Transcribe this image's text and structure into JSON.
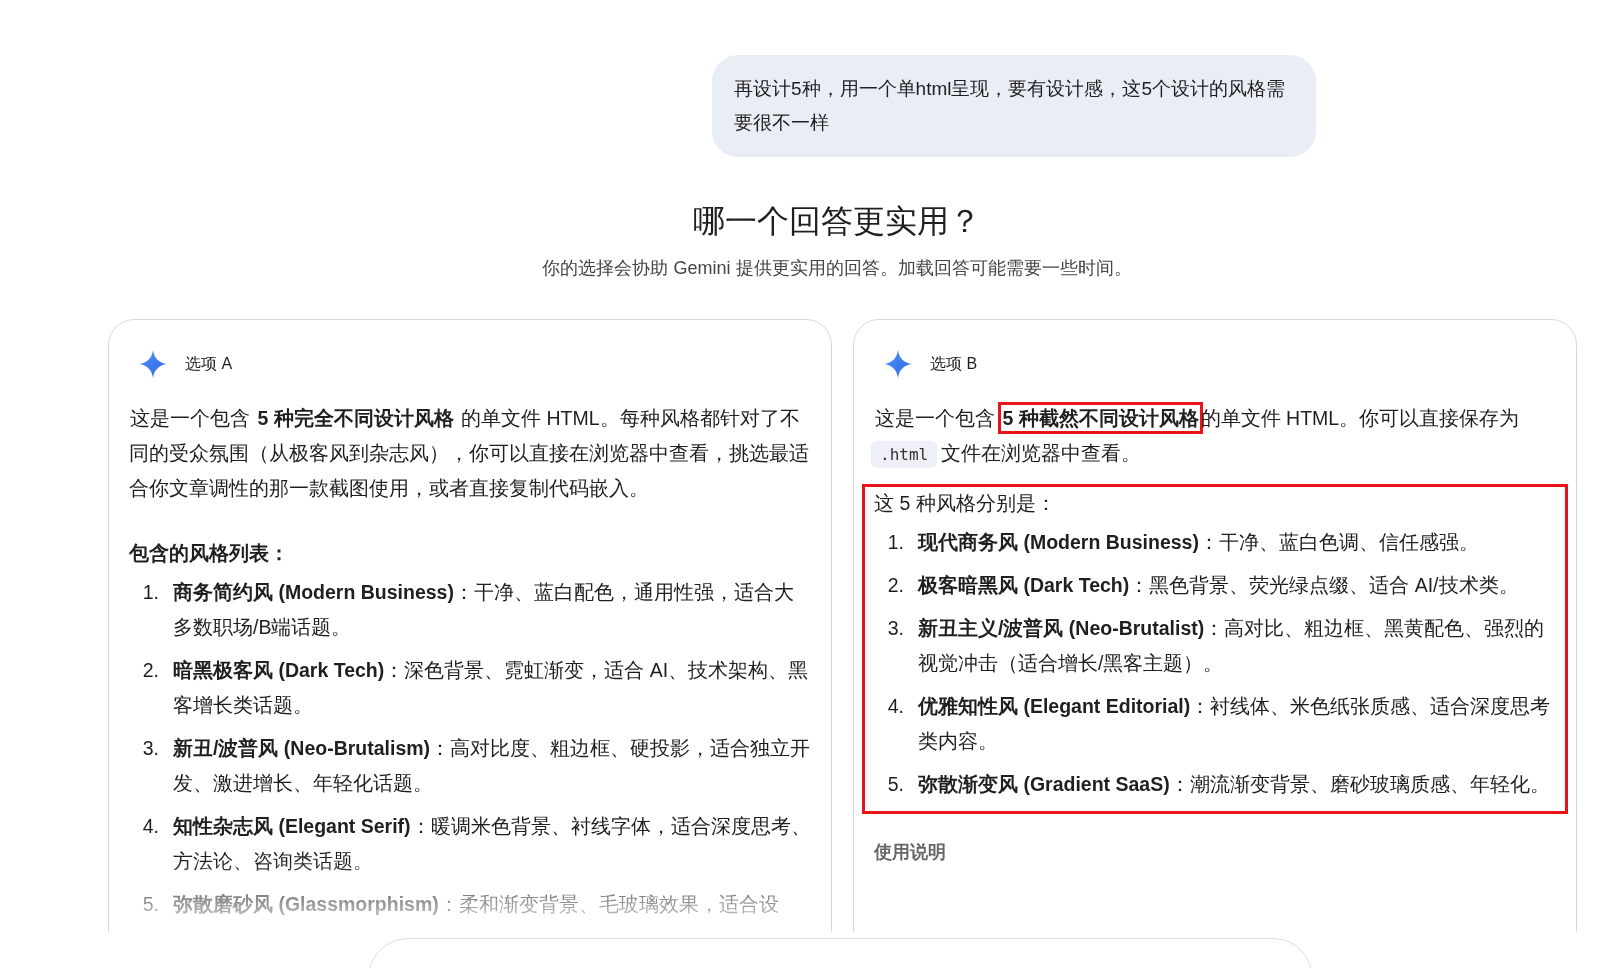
{
  "user_message": "再设计5种，用一个单html呈现，要有设计感，这5个设计的风格需要很不一样",
  "heading": "哪一个回答更实用？",
  "subheading": "你的选择会协助 Gemini 提供更实用的回答。加载回答可能需要一些时间。",
  "options": [
    {
      "label": "选项 A",
      "intro": [
        {
          "kind": "text",
          "text": "这是一个包含 ",
          "annotated": false
        },
        {
          "kind": "bold",
          "text": "5 种完全不同设计风格",
          "annotated": false
        },
        {
          "kind": "text",
          "text": " 的单文件 HTML。每种风格都针对了不同的受众氛围（从极客风到杂志风），你可以直接在浏览器中查看，挑选最适合你文章调性的那一款截图使用，或者直接复制代码嵌入。",
          "annotated": false
        }
      ],
      "list_section": {
        "kind": "heading",
        "title": "包含的风格列表：",
        "annotated": false,
        "items": [
          {
            "number": "1.",
            "text": "**商务简约风 (Modern Business)**：干净、蓝白配色，通用性强，适合大多数职场/B端话题。"
          },
          {
            "number": "2.",
            "text": "**暗黑极客风 (Dark Tech)**：深色背景、霓虹渐变，适合 AI、技术架构、黑客增长类话题。"
          },
          {
            "number": "3.",
            "text": "**新丑/波普风 (Neo-Brutalism)**：高对比度、粗边框、硬投影，适合独立开发、激进增长、年轻化话题。"
          },
          {
            "number": "4.",
            "text": "**知性杂志风 (Elegant Serif)**：暖调米色背景、衬线字体，适合深度思考、方法论、咨询类话题。"
          },
          {
            "number": "5.",
            "text": "**弥散磨砂风 (Glassmorphism)**：柔和渐变背景、毛玻璃效果，适合设"
          }
        ]
      }
    },
    {
      "label": "选项 B",
      "intro": [
        {
          "kind": "text",
          "text": "这是一个包含 ",
          "annotated": false
        },
        {
          "kind": "bold",
          "text": "5 种截然不同设计风格",
          "annotated": true
        },
        {
          "kind": "text",
          "text": "的单文件 HTML。你可以直接保存为 ",
          "annotated": false
        },
        {
          "kind": "code",
          "text": ".html",
          "annotated": false
        },
        {
          "kind": "text",
          "text": " 文件在浏览器中查看。",
          "annotated": false
        }
      ],
      "list_section": {
        "kind": "plain",
        "title": "这 5 种风格分别是：",
        "annotated": true,
        "items": [
          {
            "number": "1.",
            "text": "**现代商务风 (Modern Business)**：干净、蓝白色调、信任感强。"
          },
          {
            "number": "2.",
            "text": "**极客暗黑风 (Dark Tech)**：黑色背景、荧光绿点缀、适合 AI/技术类。"
          },
          {
            "number": "3.",
            "text": "**新丑主义/波普风 (Neo-Brutalist)**：高对比、粗边框、黑黄配色、强烈的视觉冲击（适合增长/黑客主题）。"
          },
          {
            "number": "4.",
            "text": "**优雅知性风 (Elegant Editorial)**：衬线体、米色纸张质感、适合深度思考类内容。"
          },
          {
            "number": "5.",
            "text": "**弥散渐变风 (Gradient SaaS)**：潮流渐变背景、磨砂玻璃质感、年轻化。"
          }
        ]
      },
      "after_heading": "使用说明"
    }
  ]
}
